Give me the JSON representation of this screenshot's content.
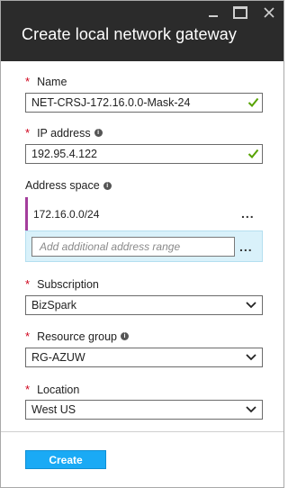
{
  "header": {
    "title": "Create local network gateway"
  },
  "fields": {
    "name": {
      "required_mark": "*",
      "label": "Name",
      "value": "NET-CRSJ-172.16.0.0-Mask-24"
    },
    "ip_address": {
      "required_mark": "*",
      "label": "IP address",
      "value": "192.95.4.122"
    },
    "address_space": {
      "label": "Address space",
      "ranges": [
        "172.16.0.0/24"
      ],
      "add_placeholder": "Add additional address range",
      "more_label": "..."
    },
    "subscription": {
      "required_mark": "*",
      "label": "Subscription",
      "value": "BizSpark"
    },
    "resource_group": {
      "required_mark": "*",
      "label": "Resource group",
      "value": "RG-AZUW"
    },
    "location": {
      "required_mark": "*",
      "label": "Location",
      "value": "West US"
    }
  },
  "footer": {
    "create_label": "Create"
  },
  "icons": {
    "info": "i",
    "check": "check-icon",
    "dropdown": "chevron-down-icon"
  },
  "colors": {
    "header_bg": "#2b2b2b",
    "required": "#d0021b",
    "valid_check": "#57a300",
    "accent_bar": "#a43e9c",
    "highlight_row": "#d9f1fa",
    "primary_button": "#1aaaf5"
  }
}
